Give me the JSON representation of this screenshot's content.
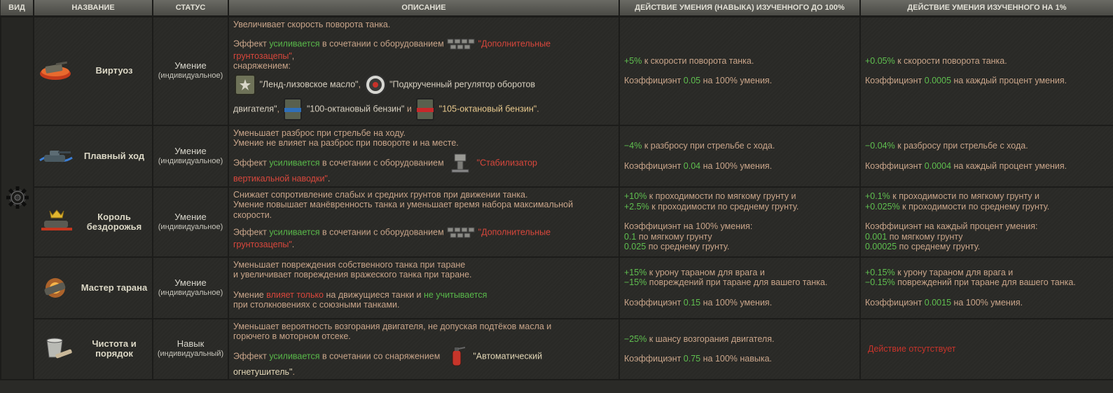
{
  "headers": {
    "vid": "ВИД",
    "name": "НАЗВАНИЕ",
    "status": "СТАТУС",
    "desc": "ОПИСАНИЕ",
    "eff100": "ДЕЙСТВИЕ УМЕНИЯ (НАВЫКА) ИЗУЧЕННОГО ДО 100%",
    "eff1": "ДЕЙСТВИЕ УМЕНИЯ ИЗУЧЕННОГО НА 1%"
  },
  "colors": {
    "green": "#59b94a",
    "red": "#d9473c",
    "item": "#e8c98e",
    "text": "#c9a58a"
  },
  "rows": [
    {
      "icon": "tank-rotate-icon",
      "name": "Виртуоз",
      "status": "Умение",
      "status_sub": "(индивидуальное)",
      "desc": {
        "l1": "Увеличивает скорость поворота танка.",
        "l2a": "Эффект ",
        "l2b": "усиливается",
        "l2c": " в сочетании с оборудованием",
        "l2d": "\"Дополнительные",
        "l3a": "грунтозацепы\"",
        "l3b": ",",
        "l4": "снаряжением:",
        "l5a": "\"Ленд-лизовское масло\"",
        "l5b": ",",
        "l5c": "\"Подкрученный регулятор оборотов",
        "l6a": "двигателя\"",
        "l6b": ",",
        "l6c": "\"100-октановый бензин\"",
        "l6d": " и ",
        "l6e": "\"105-октановый бензин\"",
        "l6f": "."
      },
      "e100": {
        "a": "+5%",
        "b": " к скорости поворота танка.",
        "c": "Коэффициэнт ",
        "d": "0.05",
        "e": " на 100% умения."
      },
      "e1": {
        "a": "+0.05%",
        "b": " к скорости поворота танка.",
        "c": "Коэффициэнт ",
        "d": "0.0005",
        "e": " на каждый процент умения."
      }
    },
    {
      "icon": "smooth-ride-icon",
      "name": "Плавный ход",
      "status": "Умение",
      "status_sub": "(индивидуальное)",
      "desc": {
        "l1": "Уменьшает разброс при стрельбе на ходу.",
        "l2": "Умение не влияет на разброс при повороте и на месте.",
        "l3a": "Эффект ",
        "l3b": "усиливается",
        "l3c": " в сочетании с оборудованием",
        "l3d": "\"Стабилизатор",
        "l4a": "вертикальной наводки\"",
        "l4b": "."
      },
      "e100": {
        "a": "−4%",
        "b": " к разбросу при стрельбе с хода.",
        "c": "Коэффициэнт ",
        "d": "0.04",
        "e": " на 100% умения."
      },
      "e1": {
        "a": "−0.04%",
        "b": " к разбросу при стрельбе с хода.",
        "c": "Коэффициэнт ",
        "d": "0.0004",
        "e": " на каждый процент умения."
      }
    },
    {
      "icon": "offroad-king-icon",
      "name_l1": "Король",
      "name_l2": "бездорожья",
      "status": "Умение",
      "status_sub": "(индивидуальное)",
      "desc": {
        "l1": "Снижает сопротивление слабых и средних грунтов при движении танка.",
        "l2": "Умение повышает манёвренность танка и уменьшает время набора максимальной",
        "l3": "скорости.",
        "l4a": "Эффект ",
        "l4b": "усиливается",
        "l4c": " в сочетании с оборудованием",
        "l4d": "\"Дополнительные",
        "l5a": "грунтозацепы\"",
        "l5b": "."
      },
      "e100": {
        "a": "+10%",
        "b": " к проходимости по мягкому грунту и",
        "c": "+2.5%",
        "d": " к проходимости по среднему грунту.",
        "e": "Коэффициэнт на 100% умения:",
        "f": "0.1",
        "g": " по мягкому грунту",
        "h": "0.025",
        "i": " по среднему грунту."
      },
      "e1": {
        "a": "+0.1%",
        "b": " к проходимости по мягкому грунту и",
        "c": "+0.025%",
        "d": " к проходимости по среднему грунту.",
        "e": "Коэффициэнт на каждый процент умения:",
        "f": "0.001",
        "g": " по мягкому грунту",
        "h": "0.00025",
        "i": " по среднему грунту."
      }
    },
    {
      "icon": "ram-master-icon",
      "name": "Мастер тарана",
      "status": "Умение",
      "status_sub": "(индивидуальное)",
      "desc": {
        "l1": "Уменьшает повреждения собственного танка при таране",
        "l2": "и увеличивает повреждения вражеского танка при таране.",
        "l3a": "Умение ",
        "l3b": "влияет только",
        "l3c": " на движущиеся танки и ",
        "l3d": "не учитывается",
        "l4": "при столкновениях с союзными танками."
      },
      "e100": {
        "a": "+15%",
        "b": " к урону тараном для врага и",
        "c": "−15%",
        "d": " повреждений при таране для вашего танка.",
        "e": "Коэффициэнт ",
        "f": "0.15",
        "g": " на 100% умения."
      },
      "e1": {
        "a": "+0.15%",
        "b": " к урону тараном для врага и",
        "c": "−0.15%",
        "d": " повреждений при таране для вашего танка.",
        "e": "Коэффициэнт ",
        "f": "0.0015",
        "g": " на 100% умения."
      }
    },
    {
      "icon": "clean-bucket-icon",
      "name_l1": "Чистота и",
      "name_l2": "порядок",
      "status": "Навык",
      "status_sub": "(индивидуальный)",
      "desc": {
        "l1": "Уменьшает вероятность возгорания двигателя, не допуская подтёков масла и",
        "l2": "горючего в моторном отсеке.",
        "l3a": "Эффект ",
        "l3b": "усиливается",
        "l3c": " в сочетании со снаряжением",
        "l3d": "\"Автоматический",
        "l4a": "огнетушитель\"",
        "l4b": "."
      },
      "e100": {
        "a": "−25%",
        "b": " к шансу возгорания двигателя.",
        "c": "Коэффициэнт ",
        "d": "0.75",
        "e": " на 100% навыка."
      },
      "e1": {
        "none": "Действие отсутствует"
      }
    }
  ]
}
